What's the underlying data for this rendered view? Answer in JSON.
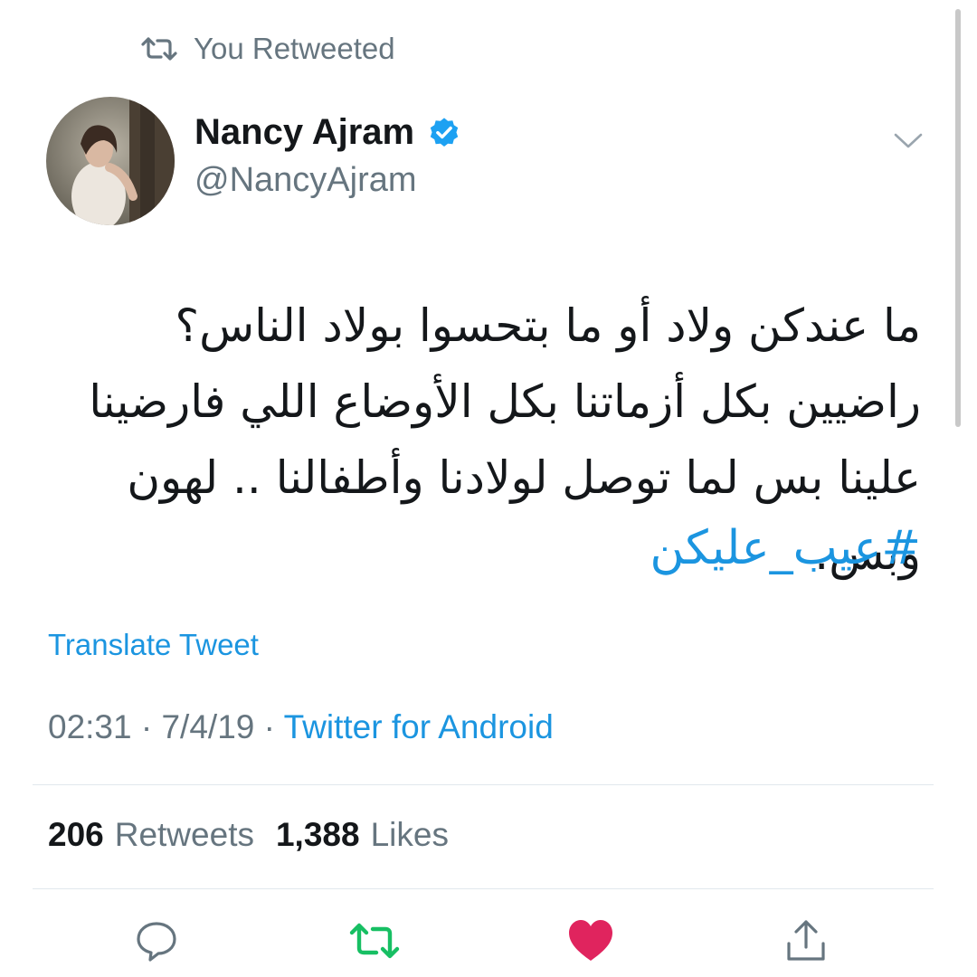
{
  "retweet_context": {
    "label": "You Retweeted",
    "icon": "retweet-icon"
  },
  "author": {
    "name": "Nancy Ajram",
    "handle": "@NancyAjram",
    "verified": true,
    "verified_icon": "verified-badge-icon",
    "avatar_icon": "avatar-photo"
  },
  "tweet": {
    "text": "ما عندكن ولاد أو ما بتحسوا بولاد الناس؟ راضيين بكل أزماتنا بكل الأوضاع اللي فارضينا علينا بس لما توصل لولادنا وأطفالنا .. لهون وبس.",
    "hashtag": "#عيب_عليكن",
    "translate_label": "Translate Tweet",
    "time": "02:31",
    "date": "7/4/19",
    "separator": "·",
    "source": "Twitter for Android"
  },
  "stats": {
    "retweets_count": "206",
    "retweets_label": "Retweets",
    "likes_count": "1,388",
    "likes_label": "Likes"
  },
  "actions": [
    {
      "name": "reply",
      "icon": "reply-icon",
      "color": "#66757f"
    },
    {
      "name": "retweet",
      "icon": "retweet-icon",
      "color": "#17bf63",
      "active": true
    },
    {
      "name": "like",
      "icon": "heart-icon",
      "color": "#e0245e",
      "active": true
    },
    {
      "name": "share",
      "icon": "share-icon",
      "color": "#66757f"
    }
  ],
  "colors": {
    "link": "#1b95e0",
    "secondary_text": "#66757f",
    "primary_text": "#14171a",
    "retweet_active": "#17bf63",
    "like_active": "#e0245e",
    "verified": "#1da1f2"
  }
}
